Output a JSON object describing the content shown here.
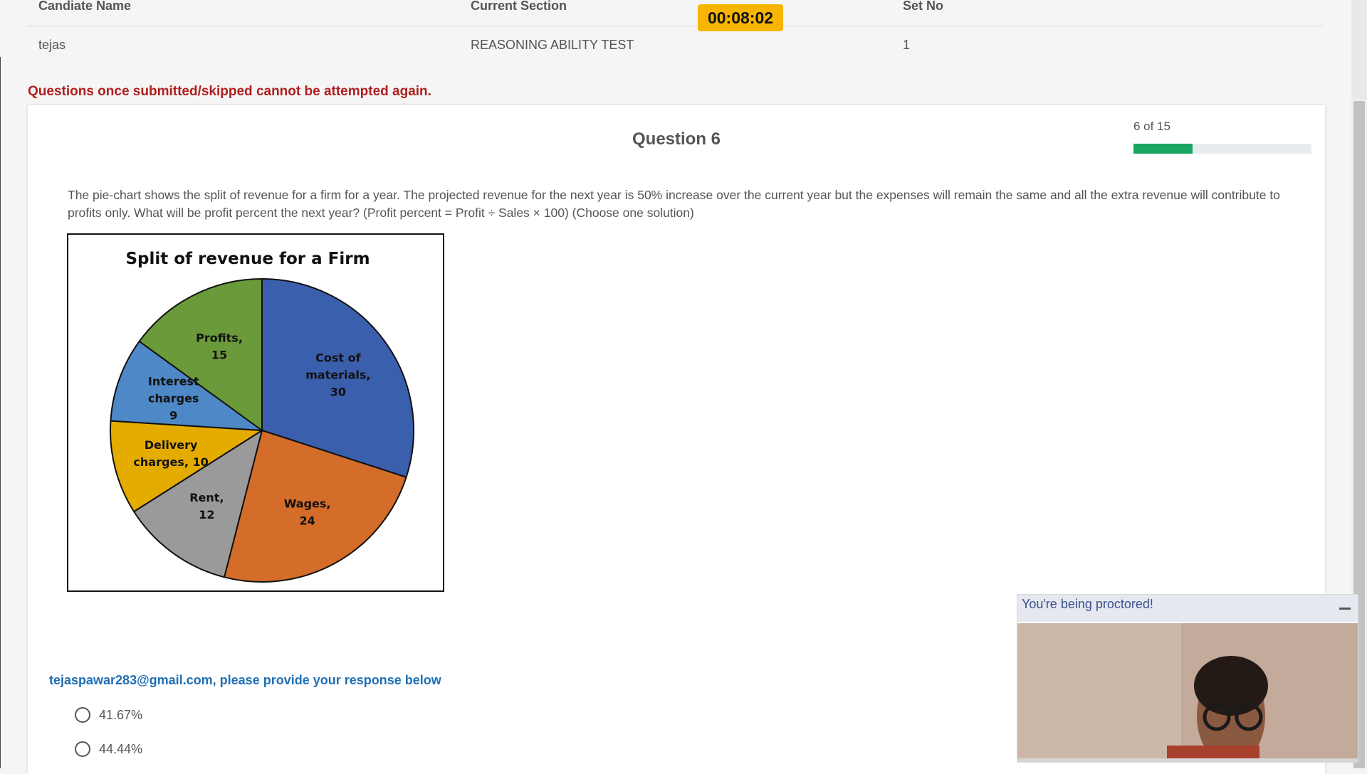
{
  "header": {
    "col1_label": "Candiate Name",
    "col2_label": "Current Section",
    "col3_label": "Set No",
    "candidate_name": "tejas",
    "current_section": "REASONING ABILITY TEST",
    "set_no": "1"
  },
  "timer": "00:08:02",
  "warning": "Questions once submitted/skipped cannot be attempted again.",
  "question": {
    "title": "Question 6",
    "progress_text": "6 of 15",
    "progress_fraction": 0.333,
    "text": "The pie-chart shows the split of revenue for a firm for a year. The projected revenue for the next year is 50% increase over the current year but the expenses will remain the same and all the extra revenue will contribute to profits only. What will be profit percent the next year? (Profit percent = Profit ÷ Sales × 100) (Choose one solution)"
  },
  "chart_data": {
    "type": "pie",
    "title": "Split of revenue for a Firm",
    "slices": [
      {
        "label": [
          "Cost of",
          "materials,",
          "30"
        ],
        "category": "Cost of materials",
        "value": 30,
        "color": "#3a5fad"
      },
      {
        "label": [
          "Wages,",
          "24"
        ],
        "category": "Wages",
        "value": 24,
        "color": "#d46c2a"
      },
      {
        "label": [
          "Rent,",
          "12"
        ],
        "category": "Rent",
        "value": 12,
        "color": "#9a9a9a"
      },
      {
        "label": [
          "Delivery",
          "charges, 10"
        ],
        "category": "Delivery charges",
        "value": 10,
        "color": "#e5ac00"
      },
      {
        "label": [
          "Interest",
          "charges",
          "9"
        ],
        "category": "Interest charges",
        "value": 9,
        "color": "#4e88c6"
      },
      {
        "label": [
          "Profits,",
          "15"
        ],
        "category": "Profits",
        "value": 15,
        "color": "#6a9a3a"
      }
    ]
  },
  "response": {
    "prompt": "tejaspawar283@gmail.com, please provide your response below",
    "options": [
      "41.67%",
      "44.44%"
    ]
  },
  "proctor": {
    "title": "You're being proctored!"
  }
}
